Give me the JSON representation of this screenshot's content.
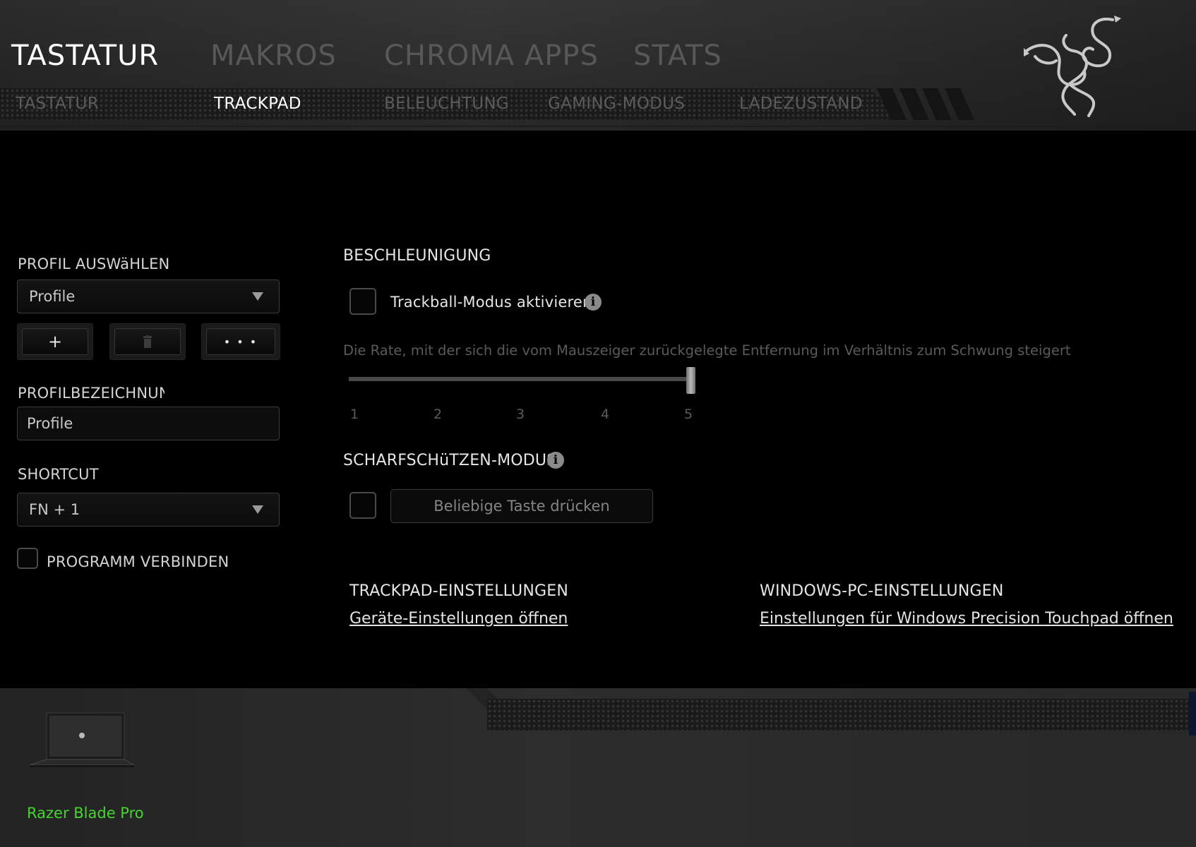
{
  "main_tabs": [
    {
      "label": "TASTATUR",
      "active": true
    },
    {
      "label": "MAKROS",
      "active": false
    },
    {
      "label": "CHROMA APPS",
      "active": false
    },
    {
      "label": "STATS",
      "active": false
    }
  ],
  "sub_tabs": [
    {
      "label": "TASTATUR",
      "active": false
    },
    {
      "label": "TRACKPAD",
      "active": true
    },
    {
      "label": "BELEUCHTUNG",
      "active": false
    },
    {
      "label": "GAMING-MODUS",
      "active": false
    },
    {
      "label": "LADEZUSTAND",
      "active": false
    }
  ],
  "profile": {
    "select_label": "PROFIL AUSWäHLEN",
    "selected": "Profile",
    "add_label": "+",
    "more_label": "• • •",
    "name_label": "PROFILBEZEICHNUNG",
    "name_value": "Profile",
    "shortcut_label": "SHORTCUT",
    "shortcut_value": "FN + 1",
    "link_program_label": "PROGRAMM VERBINDEN",
    "link_program_checked": false
  },
  "acceleration": {
    "title": "BESCHLEUNIGUNG",
    "trackball_label": "Trackball-Modus aktivieren",
    "trackball_checked": false,
    "description": "Die Rate, mit der sich die vom Mauszeiger zurückgelegte Entfernung im Verhältnis zum Schwung steigert",
    "ticks": [
      "1",
      "2",
      "3",
      "4",
      "5"
    ],
    "value": 5,
    "min": 1,
    "max": 5
  },
  "sniper": {
    "title": "SCHARFSCHüTZEN-MODUS",
    "checked": false,
    "key_placeholder": "Beliebige Taste drücken"
  },
  "trackpad_settings": {
    "title": "TRACKPAD-EINSTELLUNGEN",
    "link": "Geräte-Einstellungen öffnen"
  },
  "windows_settings": {
    "title": "WINDOWS-PC-EINSTELLUNGEN",
    "link": "Einstellungen für Windows Precision Touchpad öffnen"
  },
  "device": {
    "name": "Razer Blade Pro",
    "name_color": "#44d62c"
  },
  "colors": {
    "accent": "#44d62c",
    "active_tab": "#ffffff",
    "inactive_tab": "#585858"
  }
}
